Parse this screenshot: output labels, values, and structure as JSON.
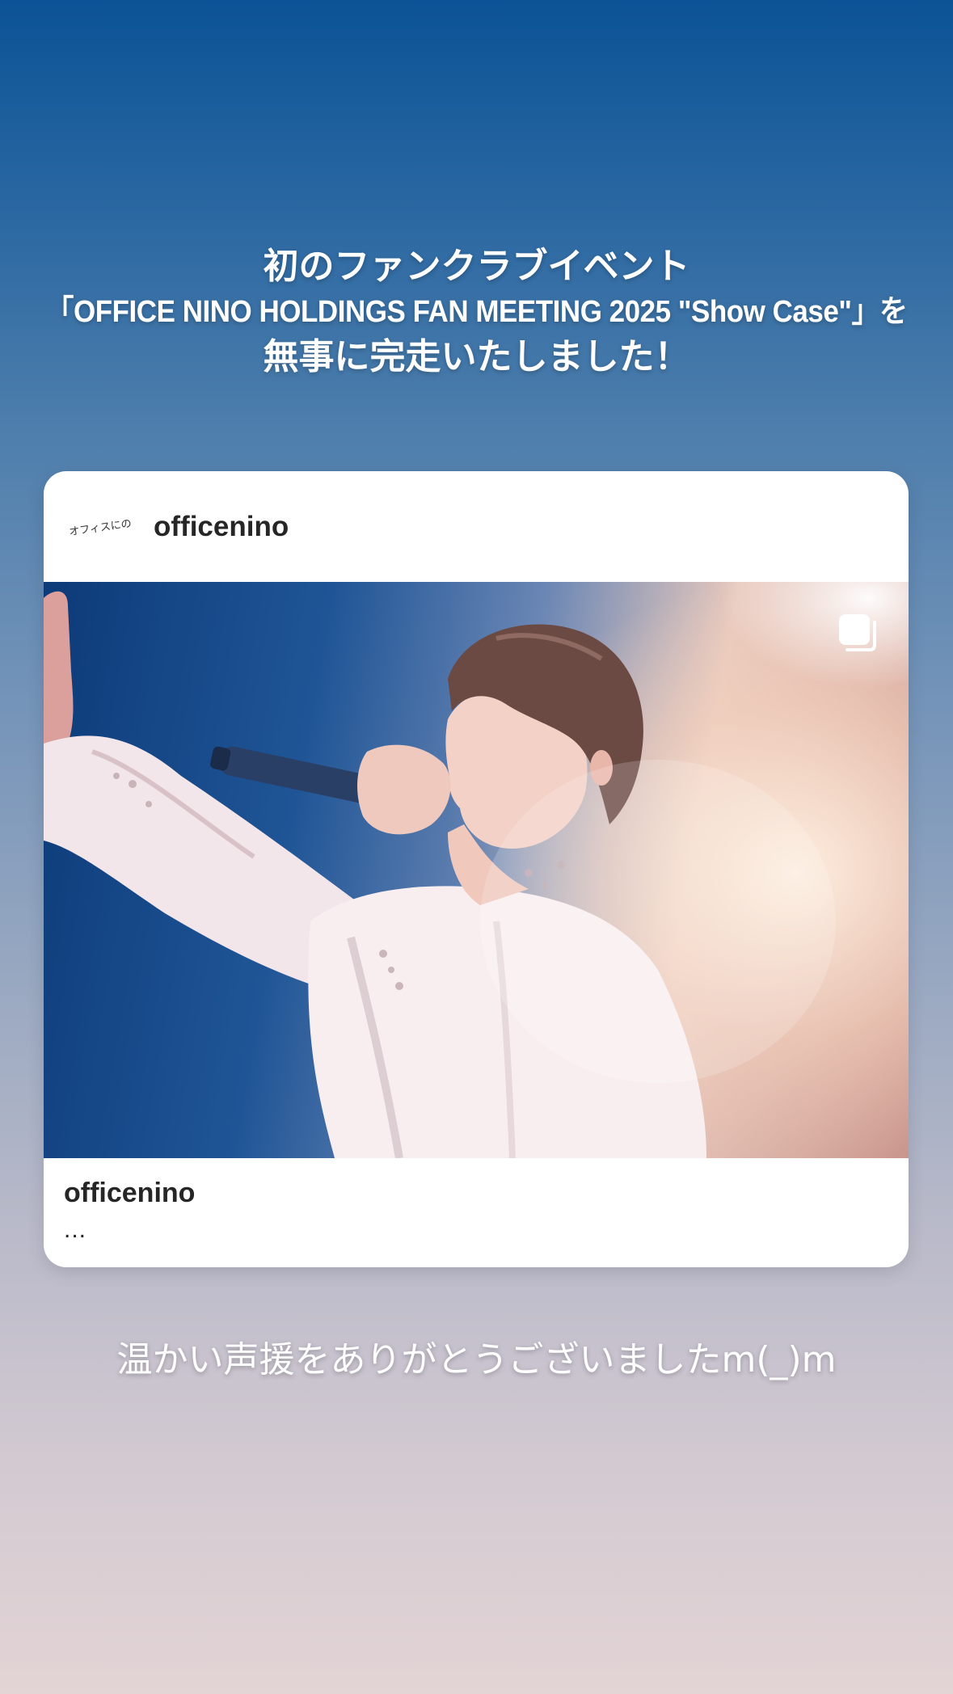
{
  "story": {
    "headline_lines": [
      "初のファンクラブイベント",
      "「OFFICE NINO HOLDINGS FAN MEETING 2025 \"Show Case\"」を",
      "無事に完走いたしました！"
    ],
    "thanks_text": "温かい声援をありがとうございましたm(_)m"
  },
  "post": {
    "avatar_text": "オフィスにの",
    "header_username": "officenino",
    "footer_username": "officenino",
    "caption_more": "...",
    "carousel_icon": "carousel-multiple-icon"
  },
  "colors": {
    "background_top": "#0b5396",
    "background_bottom": "#e3d4d5",
    "card_background": "#ffffff",
    "text_primary": "#262626"
  }
}
